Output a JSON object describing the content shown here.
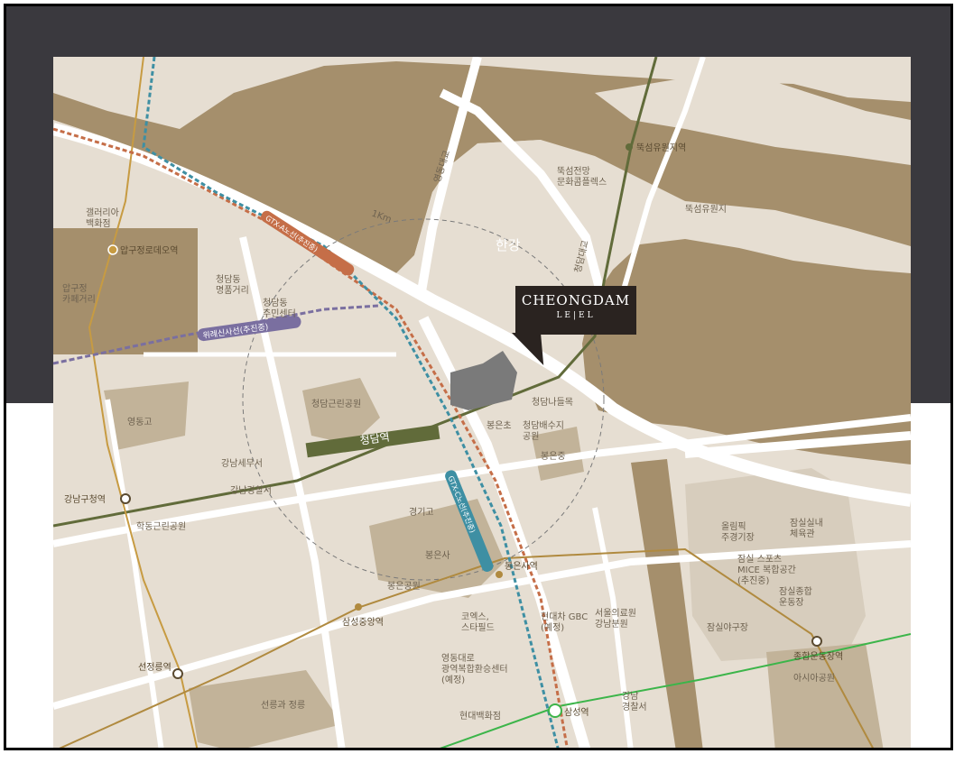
{
  "map": {
    "river_label": "한강",
    "scale_label": "1Km",
    "colors": {
      "background": "#3a393e",
      "land": "#e6ded2",
      "river": "#a58f6c",
      "park": "#c2b399",
      "road": "#ffffff",
      "line7": "#616b3a",
      "bundang": "#c79b42",
      "line2": "#3cb54a",
      "wirye": "#7a6fa0",
      "gtx_a": "#c56e48",
      "gtx_c": "#3e8fa3",
      "site": "#7a7a7a"
    },
    "icons": [
      "station-marker-icon",
      "transfer-station-icon",
      "logo-callout-icon"
    ]
  },
  "logo": {
    "name": "CHEONGDAM",
    "sub": "LE|EL"
  },
  "stations": {
    "cheongdam": "청담역",
    "ttukseom_resort": "뚝섬유원지역",
    "apgujeong_rodeo": "압구정로데오역",
    "gangnam_gu_office": "강남구청역",
    "seonjeongneung": "선정릉역",
    "samseong_jungang": "삼성중앙역",
    "bongeunsa": "봉은사역",
    "samseong": "삼성역",
    "sports_complex": "종합운동장역"
  },
  "lines": {
    "gtx_a": "GTX-A노선(추진중)",
    "gtx_c": "GTX-C노선(추진중)",
    "wirye": "위례신사선(추진중)"
  },
  "roads": {
    "yeongdong_bridge": "영동대교",
    "cheongdam_bridge": "청담대교"
  },
  "places": {
    "galleria": "갤러리아\n백화점",
    "apgujeong_cafe": "압구정\n카페거리",
    "cheongdam_luxury": "청담동\n명품거리",
    "community_center": "청담동\n주민센터",
    "cheongdam_park": "청담근린공원",
    "youngdong_high": "영동고",
    "gangnam_tax": "강남세무서",
    "gangnam_police": "강남경찰서",
    "hakdong_park": "학동근린공원",
    "kyunggi_high": "경기고",
    "bongeunsa_temple": "봉은사",
    "bongeun_park": "봉은공원",
    "bongeun_elem": "봉은초",
    "cheongdam_water": "청담배수지\n공원",
    "bongeun_middle": "봉은중",
    "cheongdam_nadeulmok": "청담나들목",
    "ttukseom_culture": "뚝섬전망\n문화콤플렉스",
    "ttukseom_park": "뚝섬유원지",
    "coex": "코엑스,\n스타필드",
    "hyundai_gbc": "현대차 GBC\n(예정)",
    "seoul_arts": "서울의료원\n강남분원",
    "yeongdong_transfer": "영동대로\n광역복합환승센터\n(예정)",
    "hyundai_dept": "현대백화점",
    "gangnam_office": "강남\n경찰서",
    "seonreung": "선릉과 정릉",
    "jamsil_main": "올림픽\n주경기장",
    "jamsil_mice": "잠실 스포츠\nMICE 복합공간\n(추진중)",
    "jamsil_gym": "잠실실내\n체육관",
    "jamsil_complex": "잠실종합\n운동장",
    "jamsil_baseball": "잠실야구장",
    "asia_park": "아시아공원"
  }
}
